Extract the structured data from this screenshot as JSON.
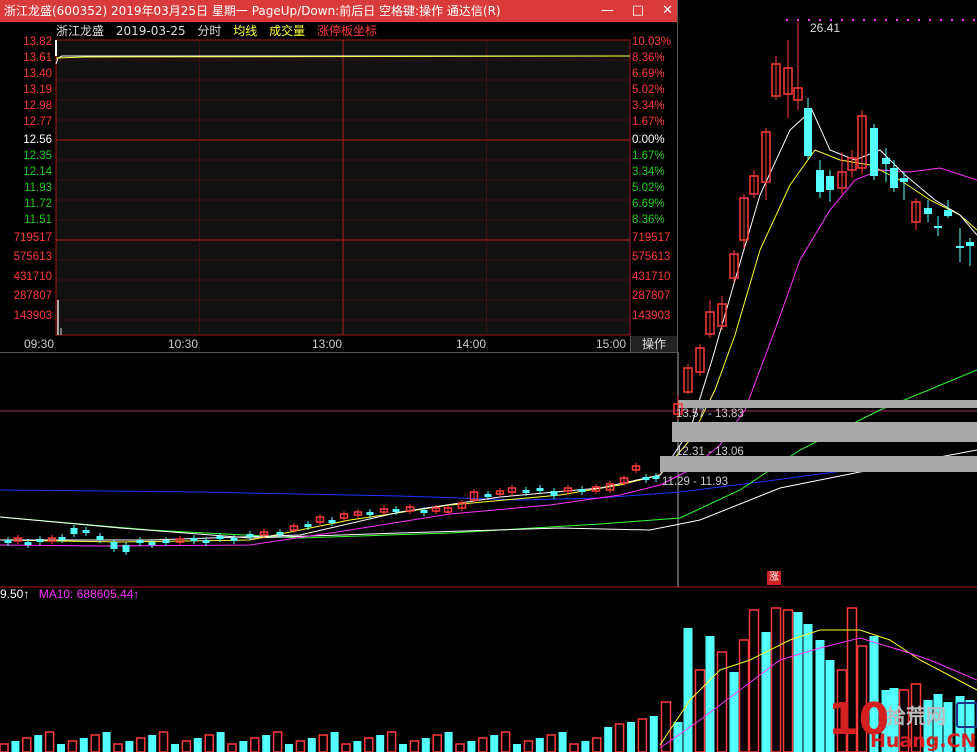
{
  "popup": {
    "title": "浙江龙盛(600352) 2019年03月25日 星期一 PageUp/Down:前后日 空格键:操作 通达信(R)",
    "buttons": {
      "min": "—",
      "max": "□",
      "close": "✕"
    },
    "info": {
      "name": "浙江龙盛",
      "date": "2019-03-25",
      "mode": "分时",
      "avg": "均线",
      "volume": "成交量",
      "limit": "涨停板坐标"
    },
    "price_labels": [
      "13.82",
      "13.61",
      "13.40",
      "13.19",
      "12.98",
      "12.77",
      "12.56",
      "12.35",
      "12.14",
      "11.93",
      "11.72",
      "11.51"
    ],
    "pct_labels": [
      "10.03%",
      "8.36%",
      "6.69%",
      "5.02%",
      "3.34%",
      "1.67%",
      "0.00%",
      "1.67%",
      "3.34%",
      "5.02%",
      "6.69%",
      "8.36%"
    ],
    "vol_labels": [
      "719517",
      "575613",
      "431710",
      "287807",
      "143903"
    ],
    "time_labels": [
      "09:30",
      "10:30",
      "13:00",
      "14:00",
      "15:00"
    ],
    "op_button": "操作",
    "colors": {
      "up": "#ff3b3b",
      "down": "#22cc22",
      "base": "#ffffff",
      "price_line": "#ffffff",
      "avg_line": "#ffff33"
    }
  },
  "main": {
    "peak_label": "26.41",
    "ranges": [
      "13.57 - 13.83",
      "12.31 - 13.06",
      "11.29 - 11.93"
    ],
    "limit_badge": "涨",
    "volume_legend": {
      "vol": "9.50↑",
      "ma10": "MA10: 688605.44↑"
    },
    "colors": {
      "up": "#ff3b3b",
      "down": "#54ffff",
      "ma_white": "#ffffff",
      "ma_yellow": "#ffff33",
      "ma_magenta": "#ff33ff",
      "ma_green": "#33ff33",
      "ma_blue": "#2233ff"
    }
  },
  "watermark": {
    "num": "10",
    "cn": "拾荒网",
    "site": "Huang.CN"
  }
}
